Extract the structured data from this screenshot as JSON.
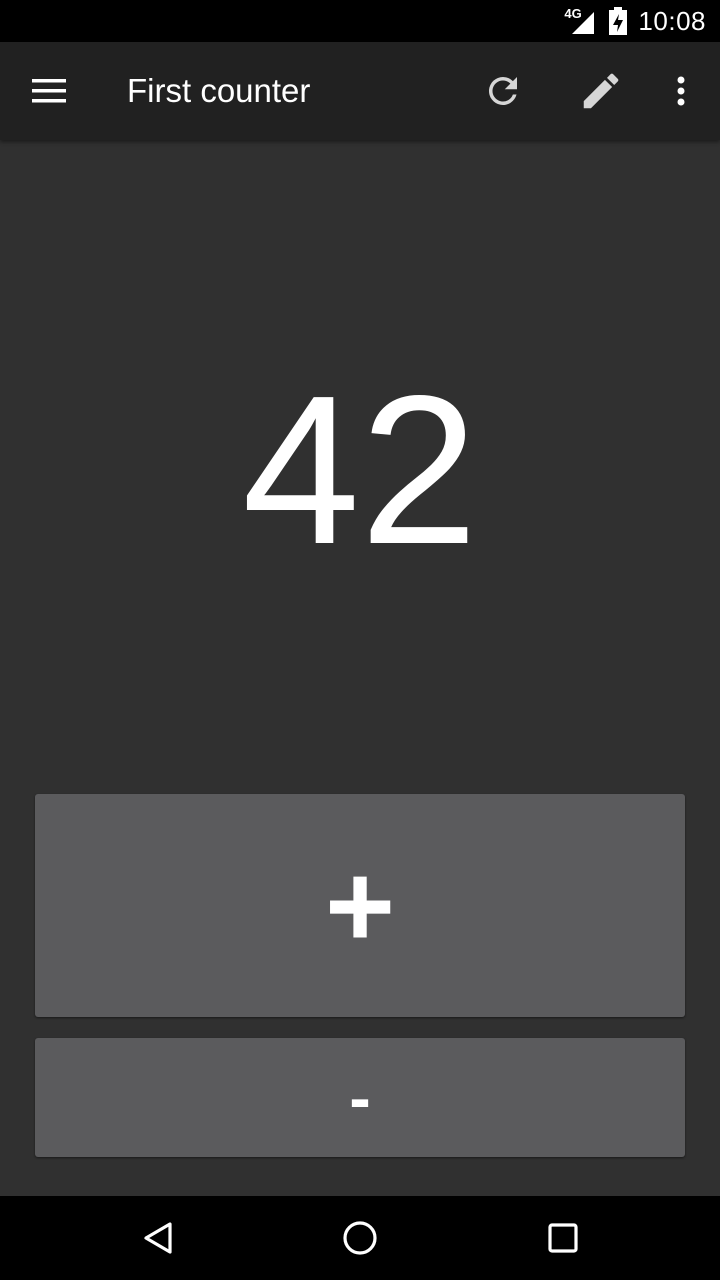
{
  "status_bar": {
    "network_label": "4G",
    "time": "10:08",
    "icons": [
      "cell-signal-icon",
      "battery-charging-icon"
    ]
  },
  "app_bar": {
    "title": "First counter",
    "icons": [
      "menu-icon",
      "refresh-icon",
      "edit-pencil-icon",
      "more-vert-icon"
    ]
  },
  "counter": {
    "value": "42"
  },
  "buttons": {
    "increment_label": "+",
    "decrement_label": "-"
  },
  "nav_bar": {
    "icons": [
      "back-triangle-icon",
      "home-circle-icon",
      "recents-square-icon"
    ]
  },
  "colors": {
    "background": "#303030",
    "app_bar": "#212121",
    "button": "#5b5b5d",
    "text": "#ffffff",
    "system_bars": "#000000"
  }
}
